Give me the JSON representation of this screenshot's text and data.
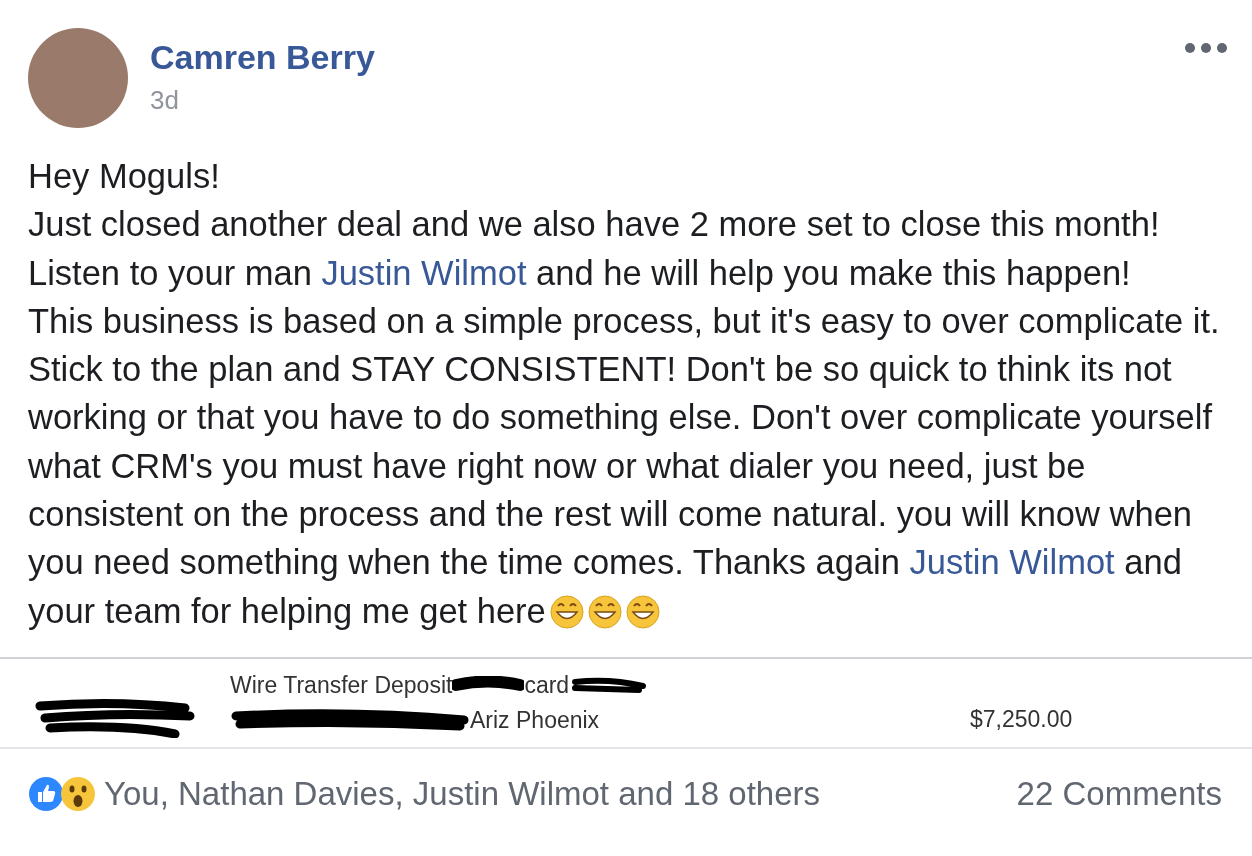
{
  "post": {
    "author": "Camren Berry",
    "time": "3d",
    "paragraphs": [
      [
        {
          "kind": "text",
          "text": "Hey Moguls!"
        }
      ],
      [
        {
          "kind": "text",
          "text": "Just closed another deal and we also have 2 more set to close this month!"
        }
      ],
      [
        {
          "kind": "text",
          "text": "Listen to your man "
        },
        {
          "kind": "link",
          "text": "Justin Wilmot"
        },
        {
          "kind": "text",
          "text": " and he will help you make this happen!"
        }
      ],
      [
        {
          "kind": "text",
          "text": "This business is based on a simple process, but it's easy to over complicate it. Stick to the plan and STAY CONSISTENT! Don't be so quick to think its not working or that you have to do something else. Don't over complicate yourself what CRM's you must have right now or what dialer you need, just be consistent on the process and the rest will come natural. you will know when you need something when the time comes. Thanks again "
        },
        {
          "kind": "link",
          "text": "Justin Wilmot"
        },
        {
          "kind": "text",
          "text": " and your team for helping me get here"
        }
      ]
    ],
    "attachment": {
      "line_1": "Wire Transfer Deposit",
      "line_1_tail": "card",
      "line_2": "Ariz Phoenix",
      "amount": "$7,250.00"
    },
    "reactions": {
      "summary": "You, Nathan Davies, Justin Wilmot and 18 others",
      "comments": "22 Comments"
    }
  }
}
